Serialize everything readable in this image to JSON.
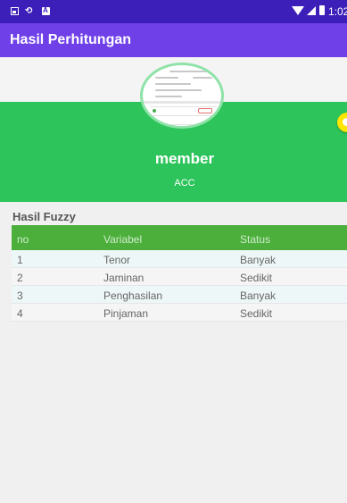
{
  "status_bar": {
    "time": "1:02",
    "icons": [
      "image-icon",
      "cast-icon",
      "a-badge-icon",
      "wifi-icon",
      "signal-icon",
      "battery-icon"
    ]
  },
  "app_bar": {
    "title": "Hasil Perhitungan"
  },
  "profile": {
    "name": "member",
    "status": "ACC",
    "colors": {
      "header": "#2dc45b",
      "app_bar": "#6f3fe8",
      "status_bar": "#3c1fb8",
      "table_header": "#4caf3c"
    }
  },
  "fuzzy": {
    "title": "Hasil Fuzzy",
    "columns": [
      "no",
      "Variabel",
      "Status"
    ],
    "rows": [
      [
        "1",
        "Tenor",
        "Banyak"
      ],
      [
        "2",
        "Jaminan",
        "Sedikit"
      ],
      [
        "3",
        "Penghasilan",
        "Banyak"
      ],
      [
        "4",
        "Pinjaman",
        "Sedikit"
      ]
    ]
  }
}
